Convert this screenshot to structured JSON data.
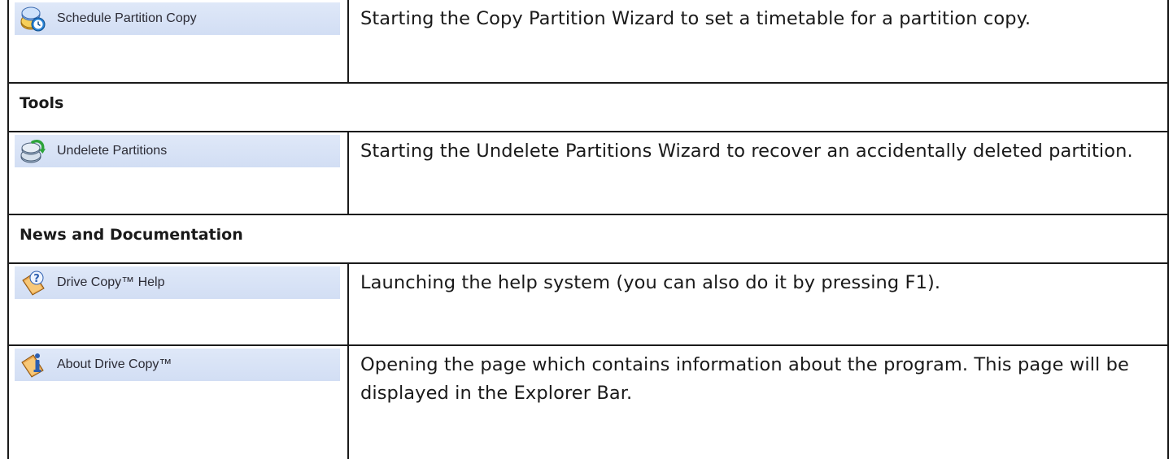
{
  "rows": [
    {
      "kind": "command",
      "label": "Schedule Partition Copy",
      "icon": "schedule-partition-copy-icon",
      "description": "Starting the Copy Partition Wizard to set a timetable for a partition copy."
    },
    {
      "kind": "section",
      "title": "Tools"
    },
    {
      "kind": "command",
      "label": "Undelete Partitions",
      "icon": "undelete-partitions-icon",
      "description": "Starting the Undelete Partitions Wizard to recover an accidentally deleted partition."
    },
    {
      "kind": "section",
      "title": "News and Documentation"
    },
    {
      "kind": "command",
      "label": "Drive Copy™ Help",
      "icon": "help-icon",
      "description": "Launching the help system (you can also do it by pressing F1)."
    },
    {
      "kind": "command",
      "label": "About Drive Copy™",
      "icon": "about-icon",
      "description": "Opening the page which contains information about the program. This page will be displayed in the Explorer Bar."
    }
  ],
  "colors": {
    "button_bg": "#d6e1f5",
    "border": "#1a1a1a",
    "text": "#1a1a1a"
  }
}
